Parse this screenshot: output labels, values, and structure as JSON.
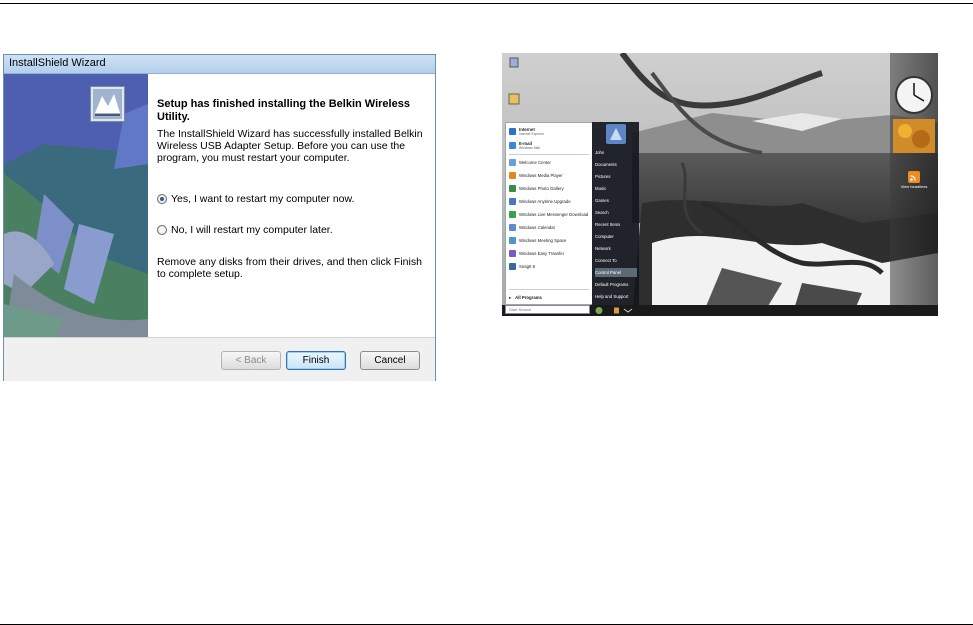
{
  "wizard": {
    "title": "InstallShield Wizard",
    "heading": "Setup has finished installing the Belkin Wireless Utility.",
    "message": "The InstallShield Wizard has successfully installed Belkin Wireless USB Adapter Setup.  Before you can use the program, you must restart your computer.",
    "options": [
      {
        "label": "Yes, I want to restart my computer now.",
        "selected": true
      },
      {
        "label": "No, I will restart my computer later.",
        "selected": false
      }
    ],
    "finish_note": "Remove any disks from their drives, and then click Finish to complete setup.",
    "buttons": {
      "back": "< Back",
      "finish": "Finish",
      "cancel": "Cancel"
    }
  },
  "desktop": {
    "start_menu": {
      "pinned": [
        {
          "label": "Internet",
          "sub": "Internet Explorer",
          "color": "#2a73c9"
        },
        {
          "label": "E-mail",
          "sub": "Windows Mail",
          "color": "#3c8ad1"
        }
      ],
      "recent": [
        {
          "label": "Welcome Center",
          "color": "#6aa0d6"
        },
        {
          "label": "Windows Media Player",
          "color": "#e08a1e"
        },
        {
          "label": "Windows Photo Gallery",
          "color": "#3c8a4a"
        },
        {
          "label": "Windows Anytime Upgrade",
          "color": "#4a78c0"
        },
        {
          "label": "Windows Live Messenger Download",
          "color": "#3aa04a"
        },
        {
          "label": "Windows Calendar",
          "color": "#5b8bd0"
        },
        {
          "label": "Windows Meeting Space",
          "color": "#4a9ac0"
        },
        {
          "label": "Windows Easy Transfer",
          "color": "#7a5bc0"
        },
        {
          "label": "SnagIt 8",
          "color": "#3a6a9a"
        }
      ],
      "all_programs": "All Programs",
      "search_placeholder": "Start Search",
      "right_items": [
        "John",
        "Documents",
        "Pictures",
        "Music",
        "Games",
        "Search",
        "Recent Items",
        "Computer",
        "Network",
        "Connect To",
        "Control Panel",
        "Default Programs",
        "Help and Support"
      ],
      "highlighted": "Control Panel"
    },
    "gadgets": {
      "feed_label": "View headlines"
    }
  }
}
